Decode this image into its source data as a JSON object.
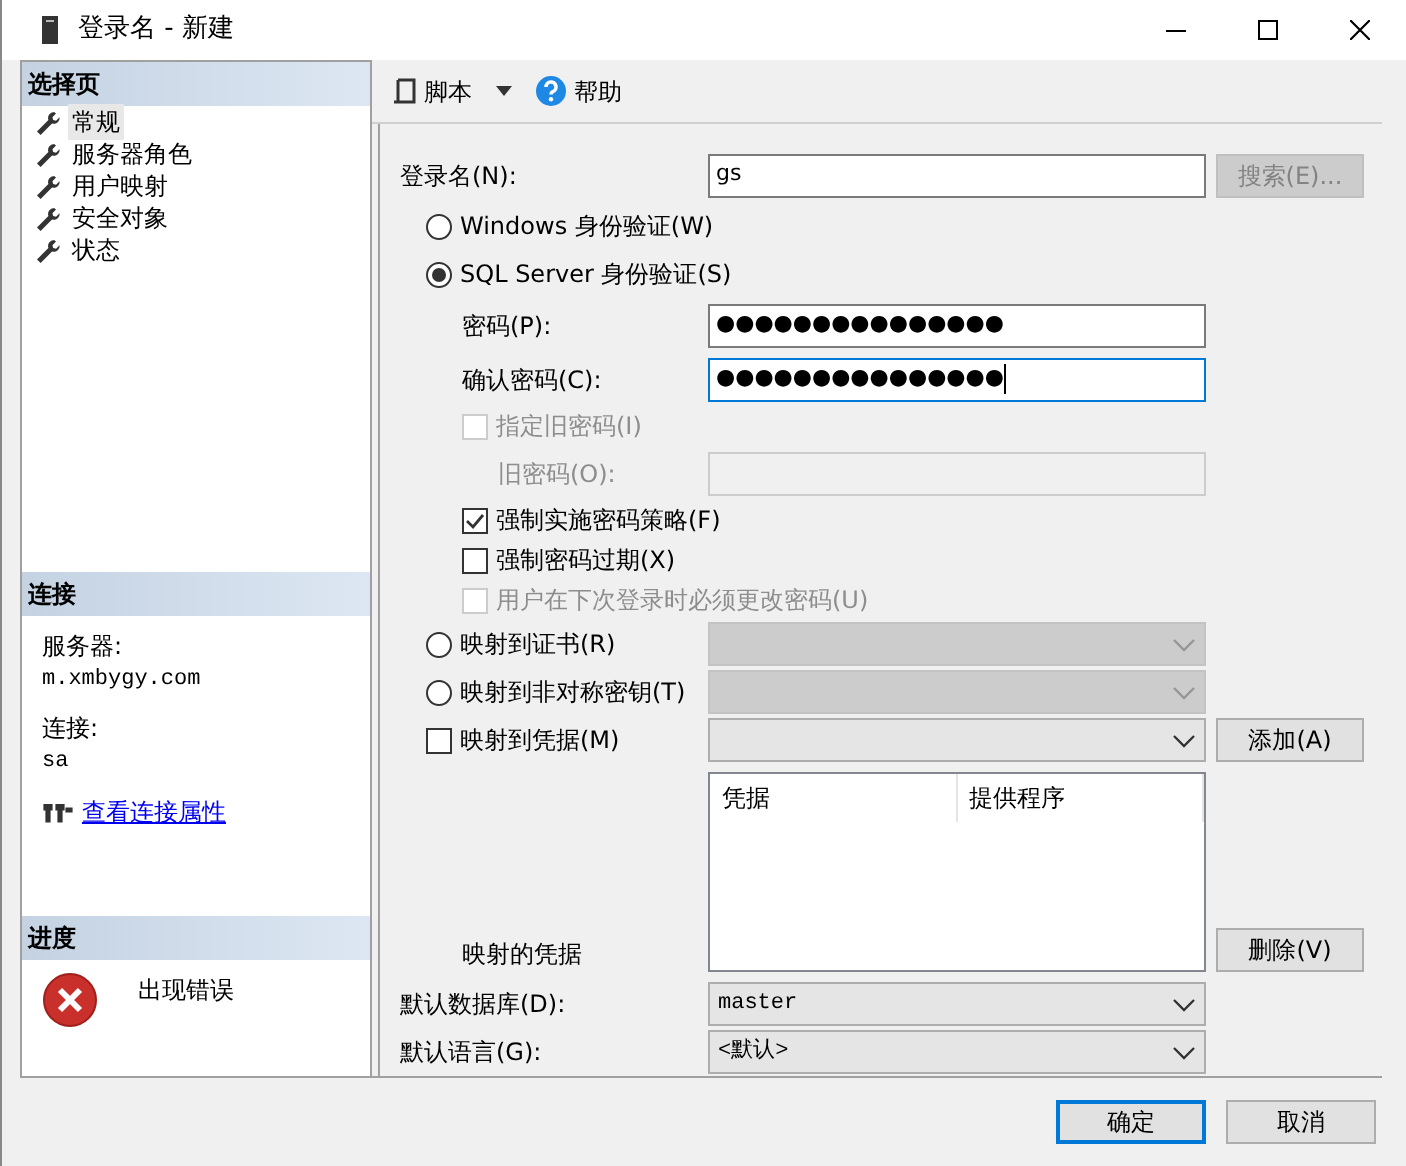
{
  "window": {
    "title": "登录名 - 新建"
  },
  "sidebar": {
    "select_pages": {
      "title": "选择页",
      "items": [
        {
          "label": "常规",
          "selected": true
        },
        {
          "label": "服务器角色",
          "selected": false
        },
        {
          "label": "用户映射",
          "selected": false
        },
        {
          "label": "安全对象",
          "selected": false
        },
        {
          "label": "状态",
          "selected": false
        }
      ]
    },
    "connection": {
      "title": "连接",
      "server_label": "服务器:",
      "server": "m.xmbygy.com",
      "connection_label": "连接:",
      "user": "sa",
      "link": "查看连接属性"
    },
    "progress": {
      "title": "进度",
      "message": "出现错误"
    }
  },
  "toolbar": {
    "script": "脚本",
    "help": "帮助"
  },
  "form": [
    {
      "kind": "text",
      "label": "登录名(N):",
      "value": "gs",
      "disabled": false,
      "button": {
        "label": "搜索(E)...",
        "disabled": true
      }
    },
    {
      "kind": "radio",
      "label": "Windows 身份验证(W)",
      "selected": false,
      "disabled": false
    },
    {
      "kind": "radio",
      "label": "SQL Server 身份验证(S)",
      "selected": true,
      "disabled": false,
      "children": [
        {
          "kind": "text",
          "label": "密码(P):",
          "value": "●●●●●●●●●●●●●●●",
          "disabled": false,
          "focused": false
        },
        {
          "kind": "text",
          "label": "确认密码(C):",
          "value": "●●●●●●●●●●●●●●●",
          "disabled": false,
          "focused": true
        },
        {
          "kind": "checkbox",
          "label": "指定旧密码(I)",
          "checked": false,
          "disabled": true,
          "children": [
            {
              "kind": "text",
              "label": "旧密码(O):",
              "disabled": true
            }
          ]
        },
        {
          "kind": "checkbox",
          "label": "强制实施密码策略(F)",
          "checked": true,
          "disabled": false
        },
        {
          "kind": "checkbox",
          "label": "强制密码过期(X)",
          "checked": false,
          "disabled": false
        },
        {
          "kind": "checkbox",
          "label": "用户在下次登录时必须更改密码(U)",
          "checked": false,
          "disabled": true
        }
      ]
    },
    {
      "kind": "radio",
      "label": "映射到证书(R)",
      "selected": false,
      "disabled": false,
      "combo": {
        "disabled": true
      }
    },
    {
      "kind": "radio",
      "label": "映射到非对称密钥(T)",
      "selected": false,
      "disabled": false,
      "combo": {
        "disabled": true
      }
    },
    {
      "kind": "checkbox",
      "label": "映射到凭据(M)",
      "checked": false,
      "disabled": false,
      "combo": {
        "disabled": false
      },
      "button": {
        "label": "添加(A)",
        "disabled": false
      },
      "children": [
        {
          "kind": "list",
          "label": "映射的凭据",
          "columns": [
            "凭据",
            "提供程序"
          ],
          "button": {
            "label": "删除(V)",
            "disabled": false
          }
        }
      ]
    },
    {
      "kind": "combo",
      "label": "默认数据库(D):",
      "combo": {
        "value": "master",
        "disabled": false
      }
    },
    {
      "kind": "combo",
      "label": "默认语言(G):",
      "combo": {
        "value": "<默认>",
        "disabled": false
      }
    }
  ],
  "footer": {
    "buttons": [
      {
        "label": "确定",
        "default": true
      },
      {
        "label": "取消",
        "default": false
      }
    ]
  }
}
